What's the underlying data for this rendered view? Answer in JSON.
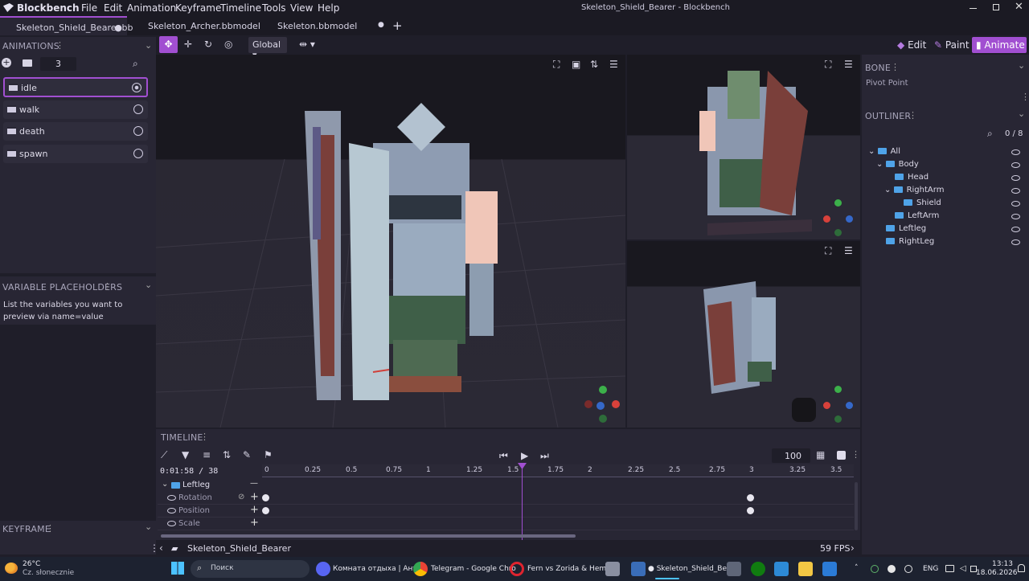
{
  "app": {
    "title": "Skeleton_Shield_Bearer - Blockbench",
    "logo": "Blockbench"
  },
  "menu": [
    "File",
    "Edit",
    "Animation",
    "Keyframe",
    "Timeline",
    "Tools",
    "View",
    "Help"
  ],
  "tabs": [
    {
      "label": "Skeleton_Shield_Bearer.bb",
      "active": true
    },
    {
      "label": "Skeleton_Archer.bbmodel",
      "active": false
    },
    {
      "label": "Skeleton.bbmodel",
      "active": false
    }
  ],
  "modes": {
    "edit": "Edit",
    "paint": "Paint",
    "animate": "Animate"
  },
  "toolbar": {
    "space": "Global"
  },
  "animations": {
    "header": "ANIMATIONS",
    "count": "3",
    "items": [
      {
        "label": "idle"
      },
      {
        "label": "walk"
      },
      {
        "label": "death"
      },
      {
        "label": "spawn"
      }
    ]
  },
  "variables": {
    "header": "VARIABLE PLACEHOLDERS",
    "text": "List the variables you want to preview via name=value"
  },
  "keyframe": {
    "header": "KEYFRAME"
  },
  "bone": {
    "header": "BONE",
    "pivot": "Pivot Point"
  },
  "outliner": {
    "header": "OUTLINER",
    "counter": "0 / 8",
    "items": [
      {
        "label": "All"
      },
      {
        "label": "Body"
      },
      {
        "label": "Head"
      },
      {
        "label": "RightArm"
      },
      {
        "label": "Shield"
      },
      {
        "label": "LeftArm"
      },
      {
        "label": "Leftleg"
      },
      {
        "label": "RightLeg"
      }
    ]
  },
  "timeline": {
    "header": "TIMELINE",
    "time": "0:01:58",
    "length": "38",
    "zoom": "100",
    "ticks": [
      "0",
      "0.25",
      "0.5",
      "0.75",
      "1",
      "1.25",
      "1.5",
      "1.75",
      "2",
      "2.25",
      "2.5",
      "2.75",
      "3",
      "3.25",
      "3.5"
    ],
    "bone": "Leftleg",
    "channels": [
      "Rotation",
      "Position",
      "Scale"
    ],
    "animation": "Skeleton_Shield_Bearer",
    "fps": "59 FPS"
  },
  "colors": {
    "accent": "#a14fd1",
    "bg": "#1f1e29",
    "panel": "#282634",
    "viewport": "#24232e"
  },
  "taskbar": {
    "weather_temp": "26°C",
    "weather_desc": "Cz. słonecznie",
    "search": "Поиск",
    "apps": [
      "Комната отдыха | Анти",
      "Telegram - Google Chro",
      "Fern vs Zorida & Hemm",
      "● Skeleton_Shield_Bear"
    ],
    "lang": "ENG",
    "time": "13:13",
    "date": "18.06.2026"
  }
}
